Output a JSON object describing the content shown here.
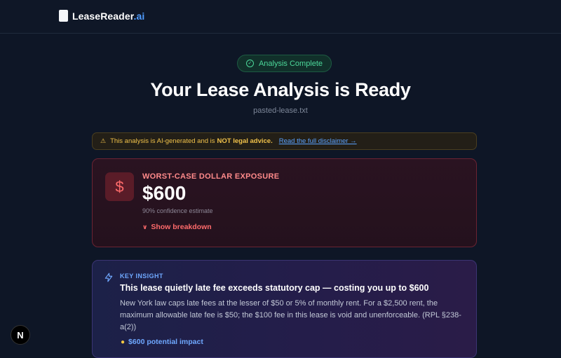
{
  "brand": {
    "name": "LeaseReader",
    "tld": ".ai"
  },
  "header": {
    "badge": "Analysis Complete",
    "title": "Your Lease Analysis is Ready",
    "filename": "pasted-lease.txt"
  },
  "disclaimer": {
    "text_before": "This analysis is AI-generated and is",
    "emphasis": "NOT legal advice.",
    "link": "Read the full disclaimer →"
  },
  "exposure": {
    "label": "WORST-CASE DOLLAR EXPOSURE",
    "value": "$600",
    "confidence": "90% confidence estimate",
    "breakdown": "Show breakdown"
  },
  "insight": {
    "label": "KEY INSIGHT",
    "title": "This lease quietly late fee exceeds statutory cap — costing you up to $600",
    "body": "New York law caps late fees at the lesser of $50 or 5% of monthly rent. For a $2,500 rent, the maximum allowable late fee is $50; the $100 fee in this lease is void and unenforceable. (RPL §238-a(2))",
    "impact": "$600 potential impact"
  },
  "dev_badge": "N",
  "colors": {
    "background": "#0e1626",
    "success": "#4cd89a",
    "warning": "#f0c14a",
    "danger": "#ff6b6b",
    "accent": "#4f9cff"
  }
}
